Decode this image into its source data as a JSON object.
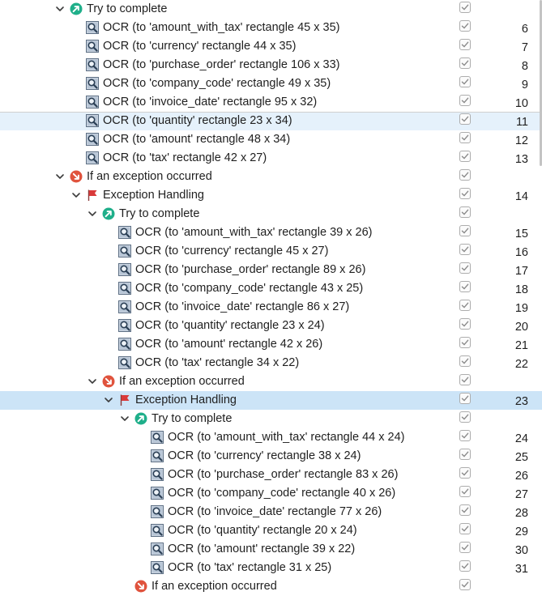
{
  "rows": [
    {
      "depth": 3,
      "expand": "down",
      "icon": "try-icon",
      "label": "Try to complete",
      "num": ""
    },
    {
      "depth": 4,
      "expand": "none",
      "icon": "ocr-icon",
      "label": "OCR (to 'amount_with_tax' rectangle 45 x 35)",
      "num": "6"
    },
    {
      "depth": 4,
      "expand": "none",
      "icon": "ocr-icon",
      "label": "OCR (to 'currency' rectangle 44 x 35)",
      "num": "7"
    },
    {
      "depth": 4,
      "expand": "none",
      "icon": "ocr-icon",
      "label": "OCR (to 'purchase_order' rectangle 106 x 33)",
      "num": "8"
    },
    {
      "depth": 4,
      "expand": "none",
      "icon": "ocr-icon",
      "label": "OCR (to 'company_code' rectangle 49 x 35)",
      "num": "9"
    },
    {
      "depth": 4,
      "expand": "none",
      "icon": "ocr-icon",
      "label": "OCR (to 'invoice_date' rectangle 95 x 32)",
      "num": "10"
    },
    {
      "depth": 4,
      "expand": "none",
      "icon": "ocr-icon",
      "label": "OCR (to 'quantity' rectangle 23 x 34)",
      "num": "11",
      "highlight": "light"
    },
    {
      "depth": 4,
      "expand": "none",
      "icon": "ocr-icon",
      "label": "OCR (to 'amount' rectangle 48 x 34)",
      "num": "12"
    },
    {
      "depth": 4,
      "expand": "none",
      "icon": "ocr-icon",
      "label": "OCR (to 'tax' rectangle 42 x 27)",
      "num": "13"
    },
    {
      "depth": 3,
      "expand": "down",
      "icon": "exception-icon",
      "label": "If an exception occurred",
      "num": ""
    },
    {
      "depth": 4,
      "expand": "down",
      "icon": "flag-icon",
      "label": "Exception Handling",
      "num": "14"
    },
    {
      "depth": 5,
      "expand": "down",
      "icon": "try-icon",
      "label": "Try to complete",
      "num": ""
    },
    {
      "depth": 6,
      "expand": "none",
      "icon": "ocr-icon",
      "label": "OCR (to 'amount_with_tax' rectangle 39 x 26)",
      "num": "15"
    },
    {
      "depth": 6,
      "expand": "none",
      "icon": "ocr-icon",
      "label": "OCR (to 'currency' rectangle 45 x 27)",
      "num": "16"
    },
    {
      "depth": 6,
      "expand": "none",
      "icon": "ocr-icon",
      "label": "OCR (to 'purchase_order' rectangle 89 x 26)",
      "num": "17"
    },
    {
      "depth": 6,
      "expand": "none",
      "icon": "ocr-icon",
      "label": "OCR (to 'company_code' rectangle 43 x 25)",
      "num": "18"
    },
    {
      "depth": 6,
      "expand": "none",
      "icon": "ocr-icon",
      "label": "OCR (to 'invoice_date' rectangle 86 x 27)",
      "num": "19"
    },
    {
      "depth": 6,
      "expand": "none",
      "icon": "ocr-icon",
      "label": "OCR (to 'quantity' rectangle 23 x 24)",
      "num": "20"
    },
    {
      "depth": 6,
      "expand": "none",
      "icon": "ocr-icon",
      "label": "OCR (to 'amount' rectangle 42 x 26)",
      "num": "21"
    },
    {
      "depth": 6,
      "expand": "none",
      "icon": "ocr-icon",
      "label": "OCR (to 'tax' rectangle 34 x 22)",
      "num": "22"
    },
    {
      "depth": 5,
      "expand": "down",
      "icon": "exception-icon",
      "label": "If an exception occurred",
      "num": ""
    },
    {
      "depth": 6,
      "expand": "down",
      "icon": "flag-icon",
      "label": "Exception Handling",
      "num": "23",
      "highlight": "selected"
    },
    {
      "depth": 7,
      "expand": "down",
      "icon": "try-icon",
      "label": "Try to complete",
      "num": ""
    },
    {
      "depth": 8,
      "expand": "none",
      "icon": "ocr-icon",
      "label": "OCR (to 'amount_with_tax' rectangle 44 x 24)",
      "num": "24"
    },
    {
      "depth": 8,
      "expand": "none",
      "icon": "ocr-icon",
      "label": "OCR (to 'currency' rectangle 38 x 24)",
      "num": "25"
    },
    {
      "depth": 8,
      "expand": "none",
      "icon": "ocr-icon",
      "label": "OCR (to 'purchase_order' rectangle 83 x 26)",
      "num": "26"
    },
    {
      "depth": 8,
      "expand": "none",
      "icon": "ocr-icon",
      "label": "OCR (to 'company_code' rectangle 40 x 26)",
      "num": "27"
    },
    {
      "depth": 8,
      "expand": "none",
      "icon": "ocr-icon",
      "label": "OCR (to 'invoice_date' rectangle 77 x 26)",
      "num": "28"
    },
    {
      "depth": 8,
      "expand": "none",
      "icon": "ocr-icon",
      "label": "OCR (to 'quantity' rectangle 20 x 24)",
      "num": "29"
    },
    {
      "depth": 8,
      "expand": "none",
      "icon": "ocr-icon",
      "label": "OCR (to 'amount' rectangle 39 x 22)",
      "num": "30"
    },
    {
      "depth": 8,
      "expand": "none",
      "icon": "ocr-icon",
      "label": "OCR (to 'tax' rectangle 31 x 25)",
      "num": "31"
    },
    {
      "depth": 7,
      "expand": "none",
      "icon": "exception-icon",
      "label": "If an exception occurred",
      "num": ""
    }
  ],
  "colors": {
    "try_green": "#1faf8a",
    "exception_red": "#e0533d",
    "flag_red": "#d93a3a",
    "row_hover": "#e5f1fb",
    "row_selected": "#cce4f7",
    "checkmark": "#8a8a8a"
  }
}
